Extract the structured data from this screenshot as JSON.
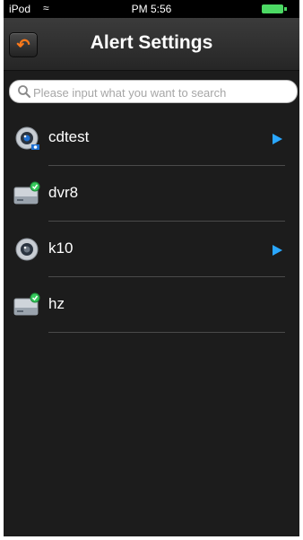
{
  "status_bar": {
    "carrier": "iPod",
    "time": "PM 5:56"
  },
  "nav": {
    "title": "Alert Settings"
  },
  "search": {
    "placeholder": "Please input what you want to search"
  },
  "devices": [
    {
      "name": "cdtest",
      "icon": "camera-icon",
      "has_arrow": true
    },
    {
      "name": "dvr8",
      "icon": "dvr-icon",
      "has_arrow": false
    },
    {
      "name": "k10",
      "icon": "camera-icon",
      "has_arrow": true
    },
    {
      "name": "hz",
      "icon": "dvr-icon",
      "has_arrow": false
    }
  ],
  "colors": {
    "accent_arrow": "#2aa7ff",
    "back_icon": "#ff7a1a",
    "status_online": "#36c95c"
  }
}
